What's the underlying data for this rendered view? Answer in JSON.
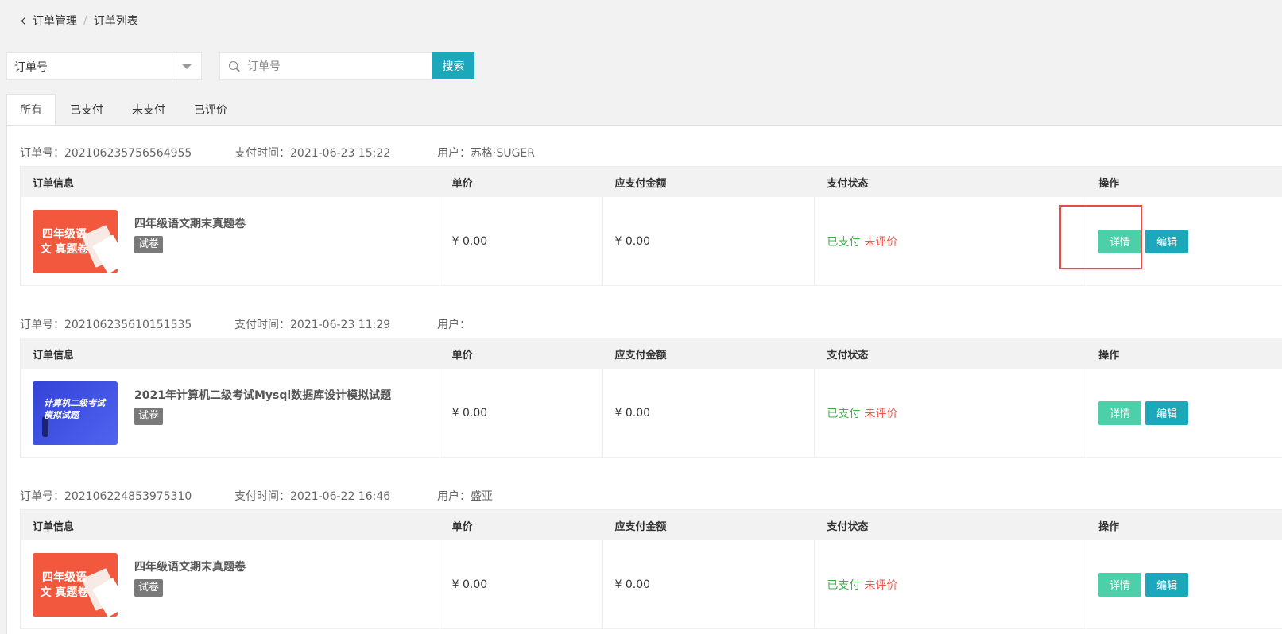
{
  "breadcrumb": {
    "parent": "订单管理",
    "separator": "/",
    "current": "订单列表"
  },
  "search": {
    "type_value": "订单号",
    "placeholder": "订单号",
    "button_label": "搜索"
  },
  "tabs": [
    {
      "label": "所有",
      "active": true
    },
    {
      "label": "已支付",
      "active": false
    },
    {
      "label": "未支付",
      "active": false
    },
    {
      "label": "已评价",
      "active": false
    }
  ],
  "table_headers": {
    "info": "订单信息",
    "price": "单价",
    "amount": "应支付金额",
    "status": "支付状态",
    "ops": "操作"
  },
  "orders": [
    {
      "order_no_label": "订单号：202106235756564955",
      "pay_time_label": "支付时间：2021-06-23 15:22",
      "user_label": "用户：苏格·SUGER",
      "product_title": "四年级语文期末真题卷",
      "product_tag": "试卷",
      "thumb_text": "四年级语文 真题卷",
      "price": "¥ 0.00",
      "amount": "¥ 0.00",
      "pay_status": "已支付",
      "review_status": "未评价",
      "detail_label": "详情",
      "edit_label": "编辑"
    },
    {
      "order_no_label": "订单号：202106235610151535",
      "pay_time_label": "支付时间：2021-06-23 11:29",
      "user_label": "用户：",
      "product_title": "2021年计算机二级考试Mysql数据库设计模拟试题",
      "product_tag": "试卷",
      "thumb_text": "计算机二级考试 模拟试题",
      "price": "¥ 0.00",
      "amount": "¥ 0.00",
      "pay_status": "已支付",
      "review_status": "未评价",
      "detail_label": "详情",
      "edit_label": "编辑"
    },
    {
      "order_no_label": "订单号：202106224853975310",
      "pay_time_label": "支付时间：2021-06-22 16:46",
      "user_label": "用户：盛亚",
      "product_title": "四年级语文期末真题卷",
      "product_tag": "试卷",
      "thumb_text": "四年级语文 真题卷",
      "price": "¥ 0.00",
      "amount": "¥ 0.00",
      "pay_status": "已支付",
      "review_status": "未评价",
      "detail_label": "详情",
      "edit_label": "编辑"
    }
  ],
  "colors": {
    "primary": "#1aa8ba",
    "detail_button": "#4dcfa9",
    "paid": "#3cb14a",
    "not_reviewed": "#e8574a",
    "highlight": "#e84a4a"
  }
}
